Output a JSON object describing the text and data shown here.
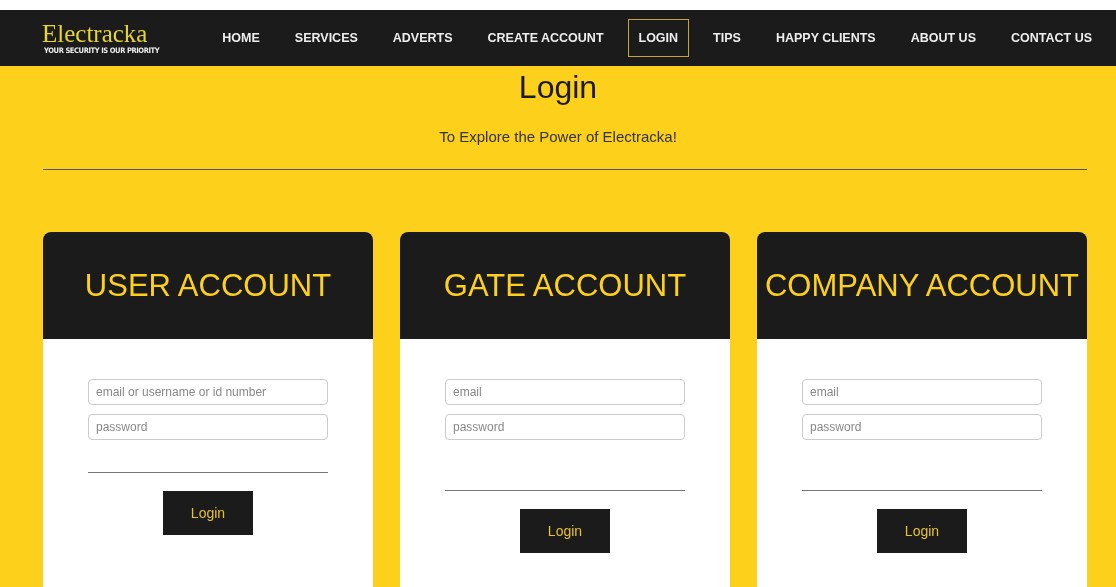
{
  "logo": {
    "name": "Electracka",
    "tagline": "YOUR SECURITY IS OUR PRIORITY"
  },
  "nav": [
    {
      "label": "HOME",
      "selected": false
    },
    {
      "label": "SERVICES",
      "selected": false
    },
    {
      "label": "ADVERTS",
      "selected": false
    },
    {
      "label": "CREATE ACCOUNT",
      "selected": false
    },
    {
      "label": "LOGIN",
      "selected": true
    },
    {
      "label": "TIPS",
      "selected": false
    },
    {
      "label": "HAPPY CLIENTS",
      "selected": false
    },
    {
      "label": "ABOUT US",
      "selected": false
    },
    {
      "label": "CONTACT US",
      "selected": false
    }
  ],
  "heading": "Login",
  "subheading": "To Explore the Power of Electracka!",
  "cards": [
    {
      "title": "USER ACCOUNT",
      "fields": [
        {
          "placeholder": "email or username or id number"
        },
        {
          "placeholder": "password"
        }
      ],
      "button": "Login"
    },
    {
      "title": "GATE ACCOUNT",
      "fields": [
        {
          "placeholder": "email"
        },
        {
          "placeholder": "password"
        }
      ],
      "button": "Login"
    },
    {
      "title": "COMPANY ACCOUNT",
      "fields": [
        {
          "placeholder": "email"
        },
        {
          "placeholder": "password"
        }
      ],
      "button": "Login"
    }
  ]
}
